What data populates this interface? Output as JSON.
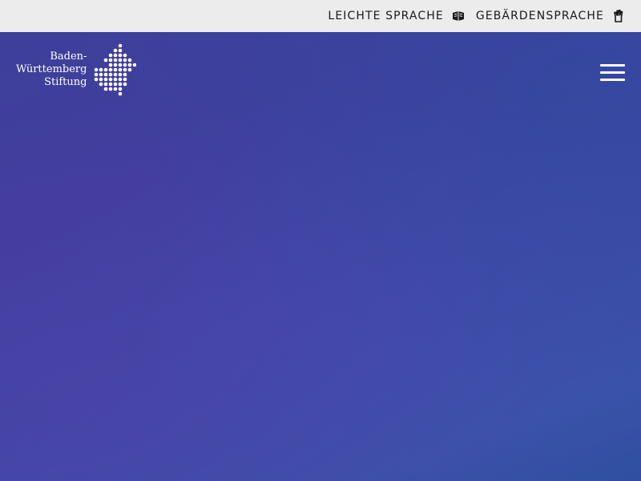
{
  "header": {
    "links": [
      {
        "label": "LEICHTE SPRACHE",
        "icon": "easy-language-book-icon"
      },
      {
        "label": "GEBÄRDENSPRACHE",
        "icon": "sign-language-hand-icon"
      }
    ]
  },
  "logo": {
    "line1": "Baden-",
    "line2": "Württemberg",
    "line3": "Stiftung",
    "mark": "dotted-state-map-icon"
  },
  "menu": {
    "icon": "hamburger-menu-icon"
  },
  "colors": {
    "topbar_bg": "#ececec",
    "hero_base": "#3f45a2",
    "text_on_hero": "#ffffff"
  }
}
